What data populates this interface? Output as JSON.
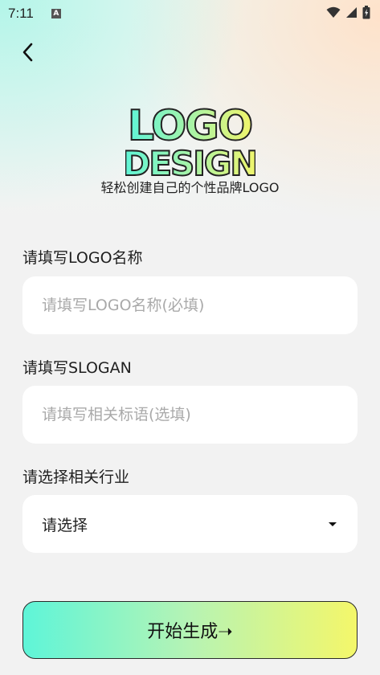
{
  "status_bar": {
    "time": "7:11",
    "notification_icon": "A"
  },
  "header": {
    "back_icon": "chevron-left"
  },
  "logo": {
    "line1": "LOGO",
    "line2": "DESIGN"
  },
  "tagline": "轻松创建自己的个性品牌LOGO",
  "form": {
    "name_label": "请填写LOGO名称",
    "name_placeholder": "请填写LOGO名称(必填)",
    "slogan_label": "请填写SLOGAN",
    "slogan_placeholder": "请填写相关标语(选填)",
    "industry_label": "请选择相关行业",
    "industry_value": "请选择"
  },
  "start_button": "开始生成➝",
  "colors": {
    "gradient_start": "#5ef5d8",
    "gradient_end": "#f4f76a",
    "field_bg": "#ffffff",
    "page_bg": "#f2f2f2"
  }
}
